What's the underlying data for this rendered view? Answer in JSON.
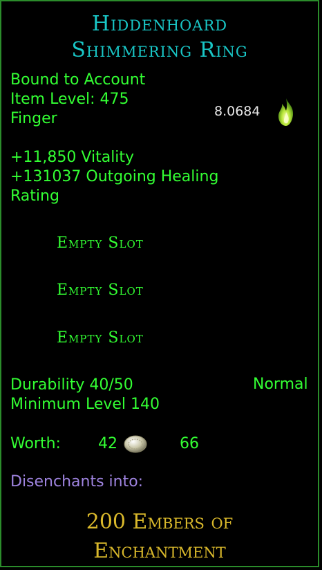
{
  "item": {
    "name_line1": "Hiddenhoard",
    "name_line2": "Shimmering Ring",
    "binding": "Bound to Account",
    "item_level": "Item Level: 475",
    "slot_type": "Finger",
    "rating_value": "8.0684",
    "stat_vitality": "+11,850 Vitality",
    "stat_healing_line1": "+131037 Outgoing Healing",
    "stat_healing_line2": "Rating",
    "empty_slots": [
      "Empty Slot",
      "Empty Slot",
      "Empty Slot"
    ],
    "durability": "Durability 40/50",
    "durability_state": "Normal",
    "minimum_level": "Minimum Level 140",
    "worth_label": "Worth:",
    "worth_silver": "42",
    "worth_copper": "66",
    "disenchants_label": "Disenchants into:",
    "disenchant_line1": "200 Embers of",
    "disenchant_line2": "Enchantment"
  },
  "icons": {
    "rating": "green-flame-icon",
    "currency": "silver-coin-icon"
  },
  "colors": {
    "title": "#19c6c6",
    "text": "#33ff33",
    "disenchant_label": "#9f84e0",
    "disenchant_item": "#d9b82b",
    "border": "#2b8c2b"
  }
}
